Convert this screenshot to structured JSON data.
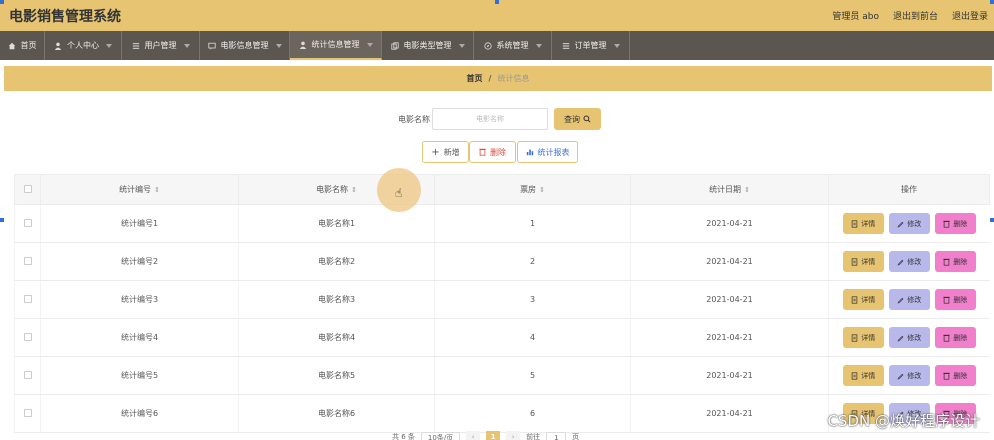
{
  "header": {
    "app_title": "电影销售管理系统",
    "links": [
      "管理员 abo",
      "退出到前台",
      "退出登录"
    ]
  },
  "nav": {
    "items": [
      {
        "label": "首页",
        "icon": "home-icon"
      },
      {
        "label": "个人中心",
        "icon": "user-icon"
      },
      {
        "label": "用户管理",
        "icon": "list-icon"
      },
      {
        "label": "电影信息管理",
        "icon": "message-icon"
      },
      {
        "label": "统计信息管理",
        "icon": "user-icon"
      },
      {
        "label": "电影类型管理",
        "icon": "copy-icon"
      },
      {
        "label": "系统管理",
        "icon": "compass-icon"
      },
      {
        "label": "订单管理",
        "icon": "list-icon"
      }
    ],
    "active_index": 4
  },
  "breadcrumb": {
    "home": "首页",
    "separator": "/",
    "current": "统计信息"
  },
  "search": {
    "label": "电影名称",
    "placeholder": "电影名称",
    "button": "查询"
  },
  "actions": {
    "add": "新增",
    "delete": "删除",
    "report": "统计报表"
  },
  "table": {
    "columns": [
      "统计编号",
      "电影名称",
      "票房",
      "统计日期",
      "操作"
    ],
    "rows": [
      {
        "code": "统计编号1",
        "movie": "电影名称1",
        "box_office": "1",
        "date": "2021-04-21"
      },
      {
        "code": "统计编号2",
        "movie": "电影名称2",
        "box_office": "2",
        "date": "2021-04-21"
      },
      {
        "code": "统计编号3",
        "movie": "电影名称3",
        "box_office": "3",
        "date": "2021-04-21"
      },
      {
        "code": "统计编号4",
        "movie": "电影名称4",
        "box_office": "4",
        "date": "2021-04-21"
      },
      {
        "code": "统计编号5",
        "movie": "电影名称5",
        "box_office": "5",
        "date": "2021-04-21"
      },
      {
        "code": "统计编号6",
        "movie": "电影名称6",
        "box_office": "6",
        "date": "2021-04-21"
      }
    ],
    "row_buttons": {
      "detail": "详情",
      "edit": "修改",
      "delete": "删除"
    }
  },
  "pagination": {
    "total": "共 6 条",
    "page_size": "10条/页",
    "current_page": "1",
    "goto_label": "前往",
    "goto_value": "1",
    "page_suffix": "页"
  },
  "watermark": "CSDN @焕好程序设计",
  "colors": {
    "accent": "#e6c472",
    "nav_bg": "#5c5650",
    "edit": "#b9b8ea",
    "delete": "#f17fcb",
    "danger_text": "#e2483d",
    "report_text": "#3a6fd8"
  }
}
